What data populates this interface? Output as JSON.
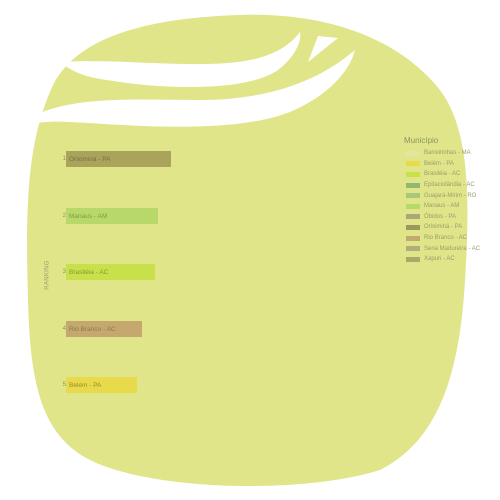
{
  "chart_data": {
    "type": "bar",
    "orientation": "horizontal",
    "ylabel": "RANKING",
    "ranks": [
      "1",
      "2",
      "3",
      "4",
      "5"
    ],
    "categories": [
      "Oriximiná - PA",
      "Manaus - AM",
      "Brasiléia - AC",
      "Rio Branco - AC",
      "Belém - PA"
    ],
    "values": [
      105,
      92,
      89,
      76,
      71
    ],
    "bar_colors": [
      "#a9a35c",
      "#b8d86a",
      "#c8e04a",
      "#c4a86e",
      "#e8da4a"
    ],
    "label_colors": [
      "#7a7040",
      "#8a9a40",
      "#8a9a30",
      "#8a7a48",
      "#9a8a30"
    ],
    "xlim": [
      0,
      105
    ],
    "legend": {
      "title": "Município",
      "position": "right",
      "items": [
        {
          "label": "Barreirinhas - MA",
          "color": "#e3e5a0"
        },
        {
          "label": "Belém - PA",
          "color": "#e8da4a"
        },
        {
          "label": "Brasiléia - AC",
          "color": "#c8e04a"
        },
        {
          "label": "Epitaciolândia - AC",
          "color": "#8fb870"
        },
        {
          "label": "Guajará-Mirim - RO",
          "color": "#a8c878"
        },
        {
          "label": "Manaus - AM",
          "color": "#b8d86a"
        },
        {
          "label": "Óbidos - PA",
          "color": "#a8a87a"
        },
        {
          "label": "Oriximiná - PA",
          "color": "#9a9a5c"
        },
        {
          "label": "Rio Branco - AC",
          "color": "#c4a86e"
        },
        {
          "label": "Sena Madureira - AC",
          "color": "#b0ae7a"
        },
        {
          "label": "Xapuri - AC",
          "color": "#a8aa6a"
        }
      ]
    }
  },
  "colors": {
    "background_blob": "#dfe588",
    "highlight_stripe": "#ffffff"
  }
}
